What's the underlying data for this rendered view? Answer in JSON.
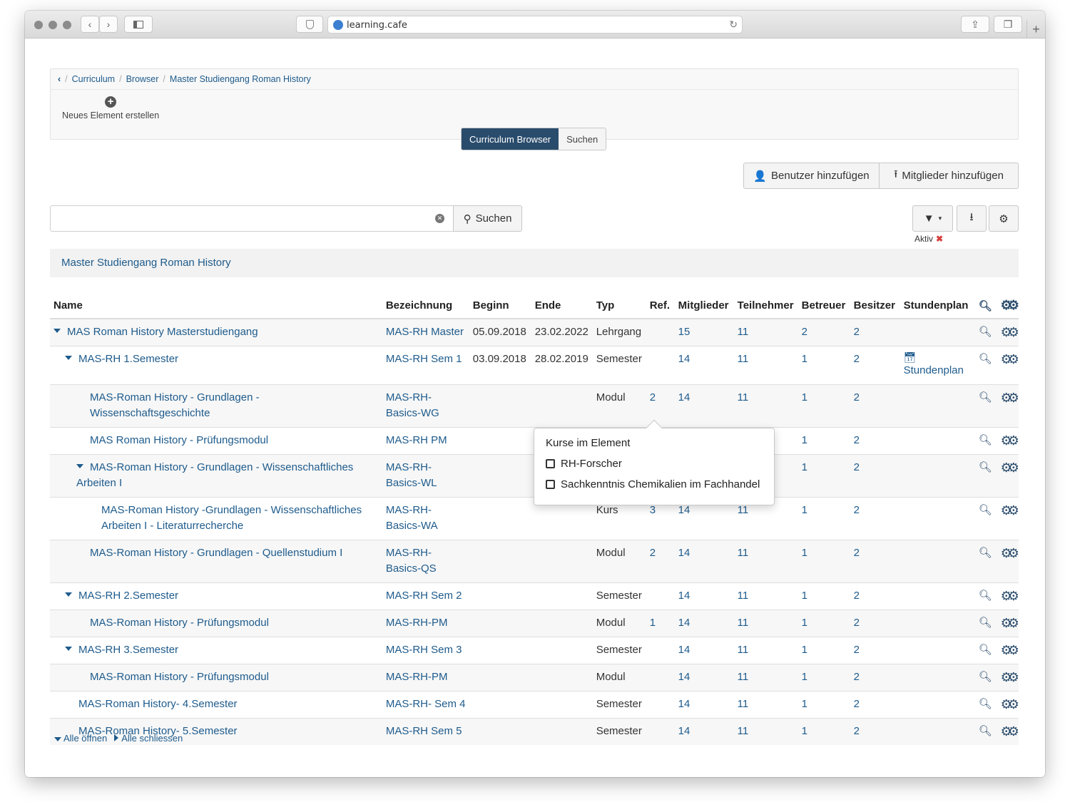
{
  "browser": {
    "url": "learning.cafe"
  },
  "breadcrumb": {
    "items": [
      "Curriculum",
      "Browser",
      "Master Studiengang Roman History"
    ]
  },
  "toolbar": {
    "new_element": "Neues Element erstellen"
  },
  "tabs": {
    "browser": "Curriculum Browser",
    "search": "Suchen"
  },
  "actions": {
    "add_user": "Benutzer hinzufügen",
    "add_members": "Mitglieder hinzufügen"
  },
  "search": {
    "value": "",
    "button": "Suchen"
  },
  "filter": {
    "status_label": "Aktiv"
  },
  "context": {
    "title": "Master Studiengang Roman History"
  },
  "table": {
    "headers": {
      "name": "Name",
      "bezeichnung": "Bezeichnung",
      "beginn": "Beginn",
      "ende": "Ende",
      "typ": "Typ",
      "ref": "Ref.",
      "mitglieder": "Mitglieder",
      "teilnehmer": "Teilnehmer",
      "betreuer": "Betreuer",
      "besitzer": "Besitzer",
      "stundenplan": "Stundenplan"
    },
    "rows": [
      {
        "name": "MAS Roman History Masterstudiengang",
        "bez": "MAS-RH Master",
        "beginn": "05.09.2018",
        "ende": "23.02.2022",
        "typ": "Lehrgang",
        "ref": "",
        "mitglieder": "15",
        "teilnehmer": "11",
        "betreuer": "2",
        "besitzer": "2",
        "stundenplan": ""
      },
      {
        "name": "MAS-RH 1.Semester",
        "bez": "MAS-RH Sem 1",
        "beginn": "03.09.2018",
        "ende": "28.02.2019",
        "typ": "Semester",
        "ref": "",
        "mitglieder": "14",
        "teilnehmer": "11",
        "betreuer": "1",
        "besitzer": "2",
        "stundenplan": "Stundenplan"
      },
      {
        "name": "MAS-Roman History - Grundlagen - Wissenschaftsgeschichte",
        "bez": "MAS-RH-Basics-WG",
        "beginn": "",
        "ende": "",
        "typ": "Modul",
        "ref": "2",
        "mitglieder": "14",
        "teilnehmer": "11",
        "betreuer": "1",
        "besitzer": "2",
        "stundenplan": ""
      },
      {
        "name": "MAS Roman History - Prüfungsmodul",
        "bez": "MAS-RH PM",
        "beginn": "",
        "ende": "",
        "typ": "",
        "ref": "",
        "mitglieder": "",
        "teilnehmer": "",
        "betreuer": "1",
        "besitzer": "2",
        "stundenplan": ""
      },
      {
        "name": "MAS-Roman History - Grundlagen - Wissenschaftliches Arbeiten I",
        "bez": "MAS-RH-Basics-WL",
        "beginn": "",
        "ende": "",
        "typ": "",
        "ref": "",
        "mitglieder": "",
        "teilnehmer": "",
        "betreuer": "1",
        "besitzer": "2",
        "stundenplan": ""
      },
      {
        "name": "MAS-Roman History -Grundlagen - Wissenschaftliches Arbeiten I - Literaturrecherche",
        "bez": "MAS-RH-Basics-WA",
        "beginn": "",
        "ende": "",
        "typ": "Kurs",
        "ref": "3",
        "mitglieder": "14",
        "teilnehmer": "11",
        "betreuer": "1",
        "besitzer": "2",
        "stundenplan": ""
      },
      {
        "name": "MAS-Roman History - Grundlagen - Quellenstudium I",
        "bez": "MAS-RH-Basics-QS",
        "beginn": "",
        "ende": "",
        "typ": "Modul",
        "ref": "2",
        "mitglieder": "14",
        "teilnehmer": "11",
        "betreuer": "1",
        "besitzer": "2",
        "stundenplan": ""
      },
      {
        "name": "MAS-RH 2.Semester",
        "bez": "MAS-RH Sem 2",
        "beginn": "",
        "ende": "",
        "typ": "Semester",
        "ref": "",
        "mitglieder": "14",
        "teilnehmer": "11",
        "betreuer": "1",
        "besitzer": "2",
        "stundenplan": ""
      },
      {
        "name": "MAS-Roman History - Prüfungsmodul",
        "bez": "MAS-RH-PM",
        "beginn": "",
        "ende": "",
        "typ": "Modul",
        "ref": "1",
        "mitglieder": "14",
        "teilnehmer": "11",
        "betreuer": "1",
        "besitzer": "2",
        "stundenplan": ""
      },
      {
        "name": "MAS-RH 3.Semester",
        "bez": "MAS-RH Sem 3",
        "beginn": "",
        "ende": "",
        "typ": "Semester",
        "ref": "",
        "mitglieder": "14",
        "teilnehmer": "11",
        "betreuer": "1",
        "besitzer": "2",
        "stundenplan": ""
      },
      {
        "name": "MAS-Roman History - Prüfungsmodul",
        "bez": "MAS-RH-PM",
        "beginn": "",
        "ende": "",
        "typ": "Modul",
        "ref": "",
        "mitglieder": "14",
        "teilnehmer": "11",
        "betreuer": "1",
        "besitzer": "2",
        "stundenplan": ""
      },
      {
        "name": "MAS-Roman History- 4.Semester",
        "bez": "MAS-RH- Sem 4",
        "beginn": "",
        "ende": "",
        "typ": "Semester",
        "ref": "",
        "mitglieder": "14",
        "teilnehmer": "11",
        "betreuer": "1",
        "besitzer": "2",
        "stundenplan": ""
      },
      {
        "name": "MAS-Roman History- 5.Semester",
        "bez": "MAS-RH Sem 5",
        "beginn": "",
        "ende": "",
        "typ": "Semester",
        "ref": "",
        "mitglieder": "14",
        "teilnehmer": "11",
        "betreuer": "1",
        "besitzer": "2",
        "stundenplan": ""
      }
    ]
  },
  "popover": {
    "title": "Kurse im Element",
    "items": [
      "RH-Forscher",
      "Sachkenntnis Chemikalien im Fachhandel"
    ]
  },
  "footer": {
    "open_all": "Alle öffnen",
    "close_all": "Alle schliessen"
  }
}
